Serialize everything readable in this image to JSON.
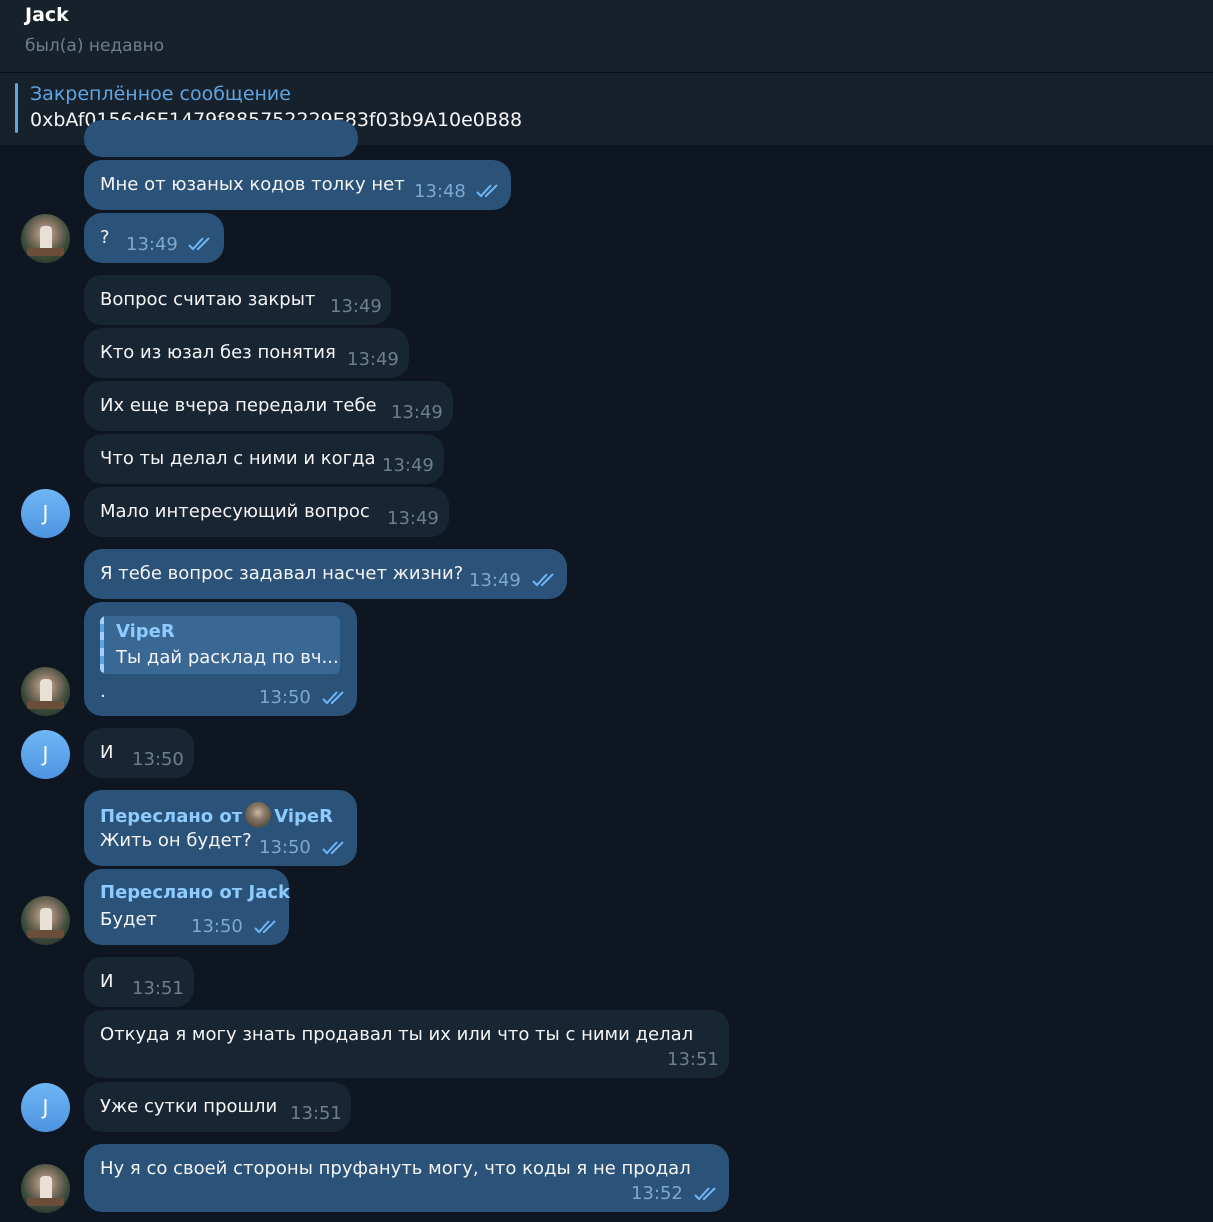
{
  "header": {
    "name": "Jack",
    "status": "был(а) недавно"
  },
  "pinned": {
    "title": "Закреплённое сообщение",
    "text": "0xbAf0156d6E1479f885752229E83f03b9A10e0B88"
  },
  "messages": [
    {
      "text": "Мне от юзаных кодов толку нет",
      "time": "13:48"
    },
    {
      "text": "?",
      "time": "13:49"
    },
    {
      "text": "Вопрос считаю закрыт",
      "time": "13:49"
    },
    {
      "text": "Кто из юзал без понятия",
      "time": "13:49"
    },
    {
      "text": "Их еще вчера передали тебе",
      "time": "13:49"
    },
    {
      "text": "Что ты делал с ними и когда",
      "time": "13:49"
    },
    {
      "text": "Мало интересующий вопрос",
      "time": "13:49"
    },
    {
      "text": "Я тебе вопрос задавал насчет жизни?",
      "time": "13:49"
    },
    {
      "reply_name": "VipeR",
      "reply_text": "Ты дай расклад по вч...",
      "text": ".",
      "time": "13:50"
    },
    {
      "text": "И",
      "time": "13:50"
    },
    {
      "forward_label": "Переслано от",
      "forward_name": "VipeR",
      "text": "Жить он будет?",
      "time": "13:50"
    },
    {
      "forward_label": "Переслано от Jack",
      "text": "Будет",
      "time": "13:50"
    },
    {
      "text": "И",
      "time": "13:51"
    },
    {
      "text": "Откуда я могу знать продавал ты их или что ты с ними делал",
      "time": "13:51"
    },
    {
      "text": "Уже сутки прошли",
      "time": "13:51"
    },
    {
      "text": "Ну я со своей стороны пруфануть могу, что коды я не продал",
      "time": "13:52"
    }
  ],
  "avatar_letter": "J",
  "colors": {
    "background": "#0e1621",
    "incoming": "#182533",
    "outgoing": "#2b5278",
    "accent": "#5ea5e3"
  }
}
